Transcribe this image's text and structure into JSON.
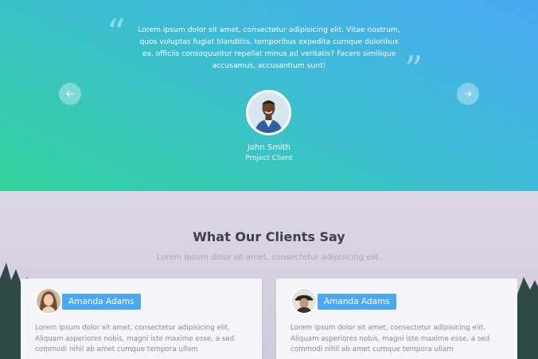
{
  "hero": {
    "quote": "Lorem ipsum dolor sit amet, consectetur adipisicing elit. Vitae nostrum, quos voluptas fugiat blanditiis, temporibus expedita cumque doloribus ea, officiis consequuntur repellat minus ad veritatis? Facere similique accusamus, accusantium sunt!",
    "quote_open_mark": "“",
    "quote_close_mark": "”",
    "client_name": "John Smith",
    "client_role": "Project Client",
    "prev_icon": "arrow-left-icon",
    "next_icon": "arrow-right-icon"
  },
  "testimonials": {
    "title": "What Our Clients Say",
    "subtitle": "Lorem Ipsum dolor sit amet, consectetur adipisicing elit.",
    "cards": [
      {
        "name": "Amanda Adams",
        "text": "Lorem ipsum dolor sit amet, consectetur adipisicing elit. Aliquam asperiores nobis, magni iste maxime esse, a sed commodi nihil ab amet cumque tempora ullam"
      },
      {
        "name": "Amanda Adams",
        "text": "Lorem ipsum dolor sit amet, consectetur adipisicing elit. Aliquam asperiores nobis, magni iste maxime esse, a sed commodi nihil ab amet cumque tempora ullam"
      }
    ]
  },
  "colors": {
    "gradient_top": "#4aa8f2",
    "gradient_bottom": "#33d39b",
    "name_badge": "#4aa8f2",
    "title_text": "#3f3f4a"
  }
}
